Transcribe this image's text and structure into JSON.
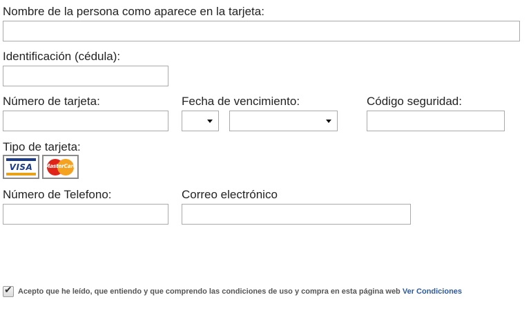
{
  "form": {
    "name_label": "Nombre de la persona como aparece en la tarjeta:",
    "name_value": "",
    "id_label": "Identificación (cédula):",
    "id_value": "",
    "card_number_label": "Número de tarjeta:",
    "card_number_value": "",
    "expiry_label": "Fecha de vencimiento:",
    "expiry_month_value": "",
    "expiry_year_value": "",
    "security_code_label": "Código seguridad:",
    "security_code_value": "",
    "card_type_label": "Tipo de tarjeta:",
    "card_types": [
      {
        "name": "VISA",
        "icon": "visa-card-icon"
      },
      {
        "name": "MasterCard",
        "icon": "mastercard-icon"
      }
    ],
    "phone_label": "Número de Telefono:",
    "phone_value": "",
    "email_label": "Correo electrónico",
    "email_value": ""
  },
  "terms": {
    "checked": true,
    "text": "Acepto que he leído, que entiendo y que comprendo las condiciones de uso y compra en esta página web",
    "link_label": "Ver Condiciones"
  },
  "colors": {
    "visa_blue": "#1a3a8a",
    "visa_gold": "#e8a21a",
    "mc_red": "#e0241a",
    "mc_yellow": "#f4a21f",
    "link": "#2a5aa0"
  }
}
